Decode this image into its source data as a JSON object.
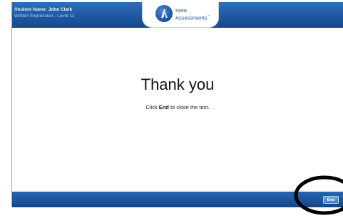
{
  "header": {
    "student_name_label": "Student Name:",
    "student_name_value": "John Clark",
    "test_info": "Written Expression - Level 11",
    "logo_line1": "Iowa",
    "logo_line2": "Assessments",
    "logo_tm": "™"
  },
  "main": {
    "title": "Thank you",
    "instruction_prefix": "Click",
    "instruction_bold": "End",
    "instruction_suffix": "to close the test."
  },
  "footer": {
    "end_label": "End"
  },
  "colors": {
    "header_blue": "#1e57a0",
    "footer_blue": "#1c539a",
    "logo_blue": "#1f5aa6",
    "annotation_ring": "#000000"
  }
}
